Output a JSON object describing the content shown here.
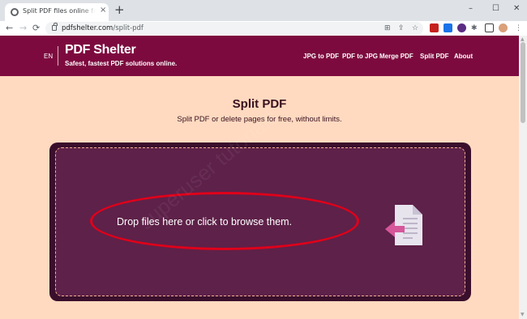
{
  "browser": {
    "tab_title": "Split PDF files online for free, with",
    "tab_close": "×",
    "new_tab": "+",
    "window_controls": {
      "minimize": "–",
      "maximize": "☐",
      "close": "✕"
    },
    "nav": {
      "back": "←",
      "forward": "→",
      "reload": "⟳"
    },
    "url_host": "pdfshelter.com",
    "url_path": "/split-pdf",
    "icons": [
      "translate-icon",
      "share-icon",
      "star-icon",
      "extension-icons",
      "profile-avatar",
      "menu-icon"
    ]
  },
  "site": {
    "lang": "EN",
    "logo": "PDF Shelter",
    "tagline": "Safest, fastest PDF solutions online.",
    "nav": [
      "JPG to PDF",
      "PDF to JPG",
      "Merge PDF",
      "Split PDF",
      "About"
    ],
    "brand_color": "#7d0a3e"
  },
  "main": {
    "title": "Split PDF",
    "subtitle": "Split PDF or delete pages for free, without limits.",
    "dropzone_text": "Drop files here or click to browse them."
  },
  "watermark": "superuser tutorials"
}
